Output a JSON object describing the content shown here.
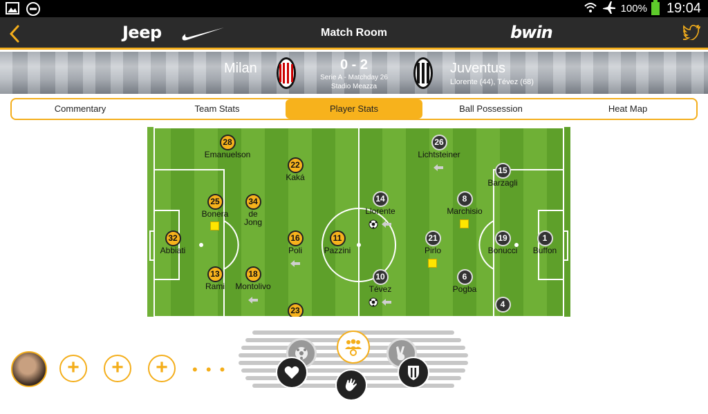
{
  "status_bar": {
    "battery": "100%",
    "time": "19:04"
  },
  "header": {
    "sponsor_left": "Jeep",
    "title": "Match Room",
    "sponsor_right": "bwin"
  },
  "match": {
    "home": "Milan",
    "away": "Juventus",
    "score": "0 - 2",
    "competition": "Serie A - Matchday 26",
    "venue": "Stadio Meazza",
    "scorers": "Llorente (44), Tévez (68)"
  },
  "tabs": [
    {
      "label": "Commentary"
    },
    {
      "label": "Team Stats"
    },
    {
      "label": "Player Stats",
      "active": true
    },
    {
      "label": "Ball Possession"
    },
    {
      "label": "Heat Map"
    }
  ],
  "home_players": [
    {
      "number": "28",
      "name": "Emanuelson"
    },
    {
      "number": "22",
      "name": "Kaká"
    },
    {
      "number": "25",
      "name": "Bonera"
    },
    {
      "number": "34",
      "name": "de\nJong"
    },
    {
      "number": "32",
      "name": "Abbiati"
    },
    {
      "number": "16",
      "name": "Poli"
    },
    {
      "number": "11",
      "name": "Pazzini"
    },
    {
      "number": "13",
      "name": "Rami"
    },
    {
      "number": "18",
      "name": "Montolivo"
    },
    {
      "number": "23",
      "name": ""
    }
  ],
  "away_players": [
    {
      "number": "26",
      "name": "Lichtsteiner"
    },
    {
      "number": "15",
      "name": "Barzagli"
    },
    {
      "number": "14",
      "name": "Llorente"
    },
    {
      "number": "8",
      "name": "Marchisio"
    },
    {
      "number": "21",
      "name": "Pirlo"
    },
    {
      "number": "19",
      "name": "Bonucci"
    },
    {
      "number": "1",
      "name": "Buffon"
    },
    {
      "number": "10",
      "name": "Tévez"
    },
    {
      "number": "6",
      "name": "Pogba"
    },
    {
      "number": "4",
      "name": ""
    }
  ],
  "colors": {
    "accent": "#f4ae1b",
    "appbar": "#2b2b2b",
    "home_badge": "#f7b21c",
    "away_badge": "#333333",
    "pitch": "#66a830"
  },
  "bottom_bar": {
    "more": "• • •"
  }
}
